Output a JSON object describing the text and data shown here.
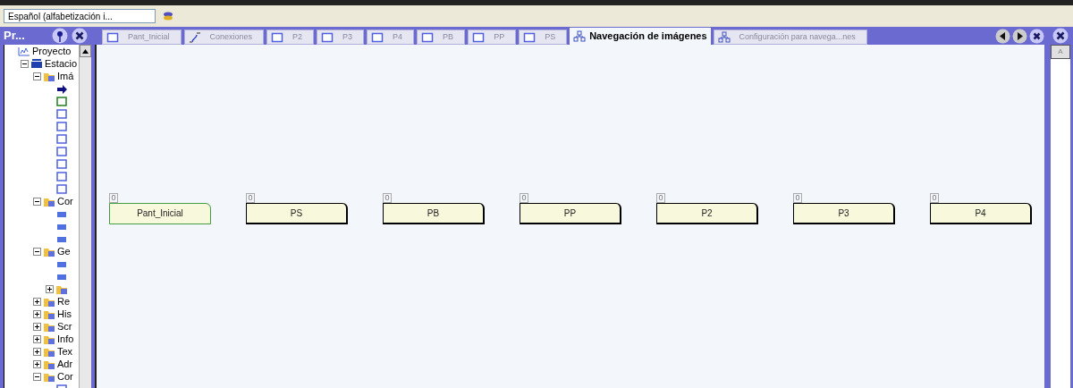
{
  "toolbar": {
    "language": "Español (alfabetización i..."
  },
  "project_panel": {
    "title": "Pr...",
    "tree": [
      {
        "label": "Proyecto",
        "kind": "project",
        "children": [
          {
            "label": "Estacio",
            "kind": "station",
            "expanded": true,
            "children": [
              {
                "label": "Imá",
                "kind": "folder",
                "expanded": true,
                "children": [
                  {
                    "kind": "arrow"
                  },
                  {
                    "kind": "screen-start"
                  },
                  {
                    "kind": "screen"
                  },
                  {
                    "kind": "screen"
                  },
                  {
                    "kind": "screen"
                  },
                  {
                    "kind": "screen"
                  },
                  {
                    "kind": "screen"
                  },
                  {
                    "kind": "screen"
                  },
                  {
                    "kind": "screen"
                  }
                ]
              },
              {
                "label": "Cor",
                "kind": "folder",
                "expanded": true,
                "children": [
                  {
                    "kind": "item"
                  },
                  {
                    "kind": "item"
                  },
                  {
                    "kind": "item"
                  }
                ]
              },
              {
                "label": "Ge",
                "kind": "folder",
                "expanded": true,
                "children": [
                  {
                    "kind": "item"
                  },
                  {
                    "kind": "item"
                  },
                  {
                    "kind": "folder",
                    "expanded": false
                  }
                ]
              },
              {
                "label": "Re",
                "kind": "folder",
                "expanded": false
              },
              {
                "label": "His",
                "kind": "folder",
                "expanded": false
              },
              {
                "label": "Scr",
                "kind": "folder",
                "expanded": false
              },
              {
                "label": "Info",
                "kind": "folder",
                "expanded": false
              },
              {
                "label": "Tex",
                "kind": "folder",
                "expanded": false
              },
              {
                "label": "Adr",
                "kind": "folder",
                "expanded": false
              },
              {
                "label": "Cor",
                "kind": "folder",
                "expanded": true,
                "children": [
                  {
                    "kind": "screen"
                  }
                ]
              }
            ]
          }
        ]
      }
    ]
  },
  "tabs": [
    {
      "label": "Pant_Inicial",
      "kind": "screen",
      "selected": false
    },
    {
      "label": "Conexiones",
      "kind": "connection",
      "selected": false
    },
    {
      "label": "P2",
      "kind": "screen",
      "selected": false
    },
    {
      "label": "P3",
      "kind": "screen",
      "selected": false
    },
    {
      "label": "P4",
      "kind": "screen",
      "selected": false
    },
    {
      "label": "PB",
      "kind": "screen",
      "selected": false
    },
    {
      "label": "PP",
      "kind": "screen",
      "selected": false
    },
    {
      "label": "PS",
      "kind": "screen",
      "selected": false
    },
    {
      "label": "Navegación de imágenes",
      "kind": "navigation",
      "selected": true
    },
    {
      "label": "Configuración para navega...nes",
      "kind": "navigation",
      "selected": false
    }
  ],
  "nodes": [
    {
      "label": "Pant_Inicial",
      "number": "0",
      "selected": true
    },
    {
      "label": "PS",
      "number": "0",
      "selected": false
    },
    {
      "label": "PB",
      "number": "0",
      "selected": false
    },
    {
      "label": "PP",
      "number": "0",
      "selected": false
    },
    {
      "label": "P2",
      "number": "0",
      "selected": false
    },
    {
      "label": "P3",
      "number": "0",
      "selected": false
    },
    {
      "label": "P4",
      "number": "0",
      "selected": false
    }
  ],
  "right_panel": {
    "label": "A"
  }
}
